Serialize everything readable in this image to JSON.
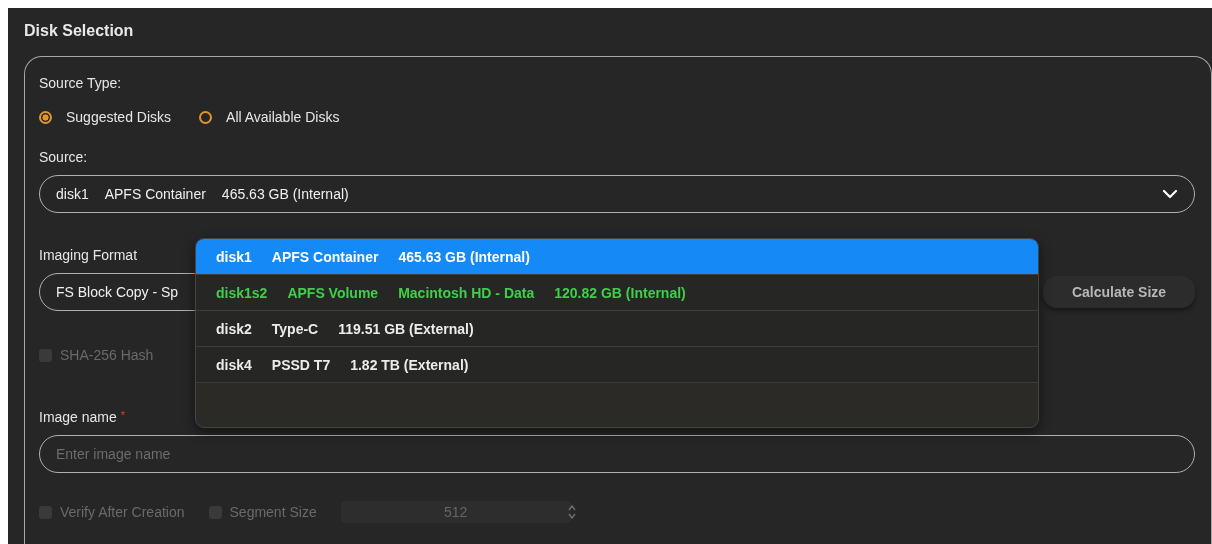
{
  "section": {
    "title": "Disk Selection"
  },
  "source_type": {
    "label": "Source Type:",
    "options": [
      {
        "label": "Suggested Disks",
        "selected": true
      },
      {
        "label": "All Available Disks",
        "selected": false
      }
    ]
  },
  "source": {
    "label": "Source:",
    "value": [
      "disk1",
      "APFS Container",
      "465.63 GB (Internal)"
    ]
  },
  "imaging_format": {
    "label": "Imaging Format",
    "value": "FS Block Copy - Sp",
    "button": "Calculate Size"
  },
  "hash_options": [
    {
      "label": "SHA-256 Hash",
      "checked": false,
      "disabled": true
    }
  ],
  "image_name": {
    "label": "Image name",
    "required_mark": "*",
    "placeholder": "Enter image name"
  },
  "verify": {
    "label": "Verify After Creation",
    "checked": false,
    "disabled": true
  },
  "segment": {
    "label": "Segment Size",
    "checked": false,
    "disabled": true,
    "value": "512"
  },
  "dropdown": {
    "items": [
      {
        "parts": [
          "disk1",
          "APFS Container",
          "465.63 GB (Internal)"
        ],
        "selected": true,
        "highlighted": false
      },
      {
        "parts": [
          "disk1s2",
          "APFS Volume",
          "Macintosh HD - Data",
          "120.82 GB (Internal)"
        ],
        "selected": false,
        "highlighted": true
      },
      {
        "parts": [
          "disk2",
          "Type-C",
          "119.51 GB (External)"
        ],
        "selected": false,
        "highlighted": false
      },
      {
        "parts": [
          "disk4",
          "PSSD T7",
          "1.82 TB (External)"
        ],
        "selected": false,
        "highlighted": false
      }
    ]
  }
}
